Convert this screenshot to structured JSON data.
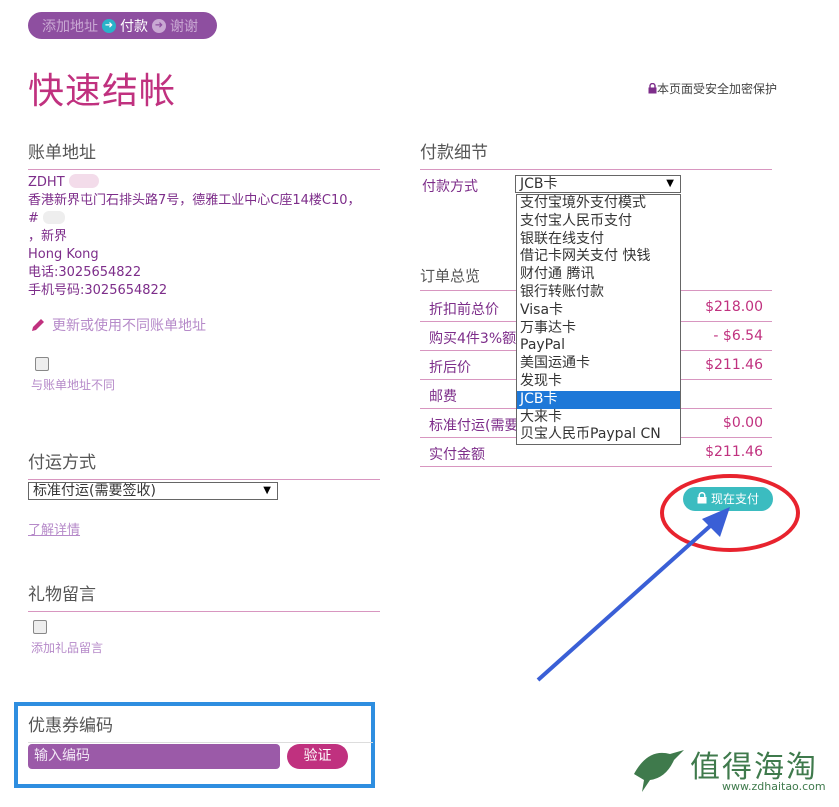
{
  "progress": {
    "step1": "添加地址",
    "step2": "付款",
    "step3": "谢谢"
  },
  "page_title": "快速结帐",
  "secure_note": "本页面受安全加密保护",
  "billing": {
    "title": "账单地址",
    "name": "ZDHT",
    "line1": "香港新界屯门石排头路7号，德雅工业中心C座14楼C10，",
    "line2": "#",
    "line3": "，新界",
    "line4": "Hong Kong",
    "phone": "电话:3025654822",
    "mobile": "手机号码:3025654822",
    "edit_link": "更新或使用不同账单地址",
    "diff_label": "与账单地址不同"
  },
  "shipping": {
    "title": "付运方式",
    "selected": "标准付运(需要签收)",
    "details_link": "了解详情"
  },
  "gift": {
    "title": "礼物留言",
    "label": "添加礼品留言"
  },
  "coupon": {
    "title": "优惠券编码",
    "placeholder": "输入编码",
    "button": "验证"
  },
  "payment": {
    "title": "付款细节",
    "method_label": "付款方式",
    "selected": "JCB卡",
    "options": [
      "支付宝境外支付模式",
      "支付宝人民币支付",
      "银联在线支付",
      "借记卡网关支付 快钱",
      "财付通 腾讯",
      "银行转账付款",
      "Visa卡",
      "万事达卡",
      "PayPal",
      "美国运通卡",
      "发现卡",
      "JCB卡",
      "大来卡",
      "贝宝人民币Paypal CN"
    ],
    "selected_index": 11
  },
  "summary": {
    "title": "订单总览",
    "rows": [
      {
        "label": "折扣前总价",
        "value": "$218.00"
      },
      {
        "label": "购买4件3%额外",
        "value": "- $6.54"
      },
      {
        "label": "折后价",
        "value": "$211.46"
      },
      {
        "label": "邮费",
        "value": ""
      },
      {
        "label": "标准付运(需要",
        "value": "$0.00"
      },
      {
        "label": "实付金额",
        "value": "$211.46"
      }
    ],
    "pay_button": "现在支付"
  },
  "watermark": {
    "cn": "值得海淘",
    "url": "www.zdhaitao.com"
  },
  "colors": {
    "brand": "#c0317f",
    "purple": "#8e4fa0",
    "teal": "#3bbcc0",
    "highlight": "#1e78d8",
    "annotation_red": "#e8232e",
    "annotation_blue": "#2e8ee0"
  }
}
